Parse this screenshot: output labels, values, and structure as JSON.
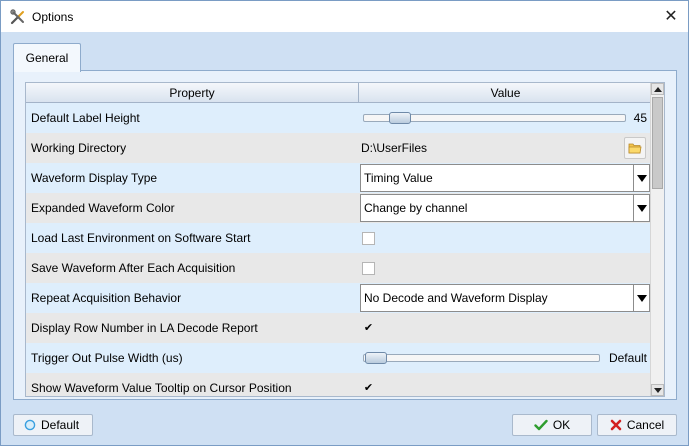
{
  "window": {
    "title": "Options",
    "close_glyph": "✕"
  },
  "tabs": [
    {
      "label": "General"
    }
  ],
  "grid": {
    "headers": {
      "property": "Property",
      "value": "Value"
    },
    "rows": {
      "r0": {
        "label": "Default Label Height",
        "slider_fraction": 0.1,
        "value_text": "45"
      },
      "r1": {
        "label": "Working Directory",
        "value_text": "D:\\UserFiles"
      },
      "r2": {
        "label": "Waveform Display Type",
        "value_text": "Timing Value"
      },
      "r3": {
        "label": "Expanded Waveform Color",
        "value_text": "Change by channel"
      },
      "r4": {
        "label": "Load Last Environment on Software Start",
        "checked": false
      },
      "r5": {
        "label": "Save Waveform After Each Acquisition",
        "checked": false
      },
      "r6": {
        "label": "Repeat Acquisition Behavior",
        "value_text": "No Decode and Waveform Display"
      },
      "r7": {
        "label": "Display Row Number in LA Decode Report",
        "checked": true,
        "check_glyph": "✔"
      },
      "r8": {
        "label": "Trigger Out Pulse Width (us)",
        "slider_fraction": 0.0,
        "value_text": "Default"
      },
      "r9": {
        "label": "Show Waveform Value Tooltip on Cursor Position",
        "checked": true,
        "check_glyph": "✔"
      }
    }
  },
  "buttons": {
    "default_label": "Default",
    "ok_label": "OK",
    "cancel_label": "Cancel"
  },
  "colors": {
    "ok_check": "#2e9d2e",
    "cancel_x": "#d32020",
    "default_circle": "#3aa0e0"
  }
}
